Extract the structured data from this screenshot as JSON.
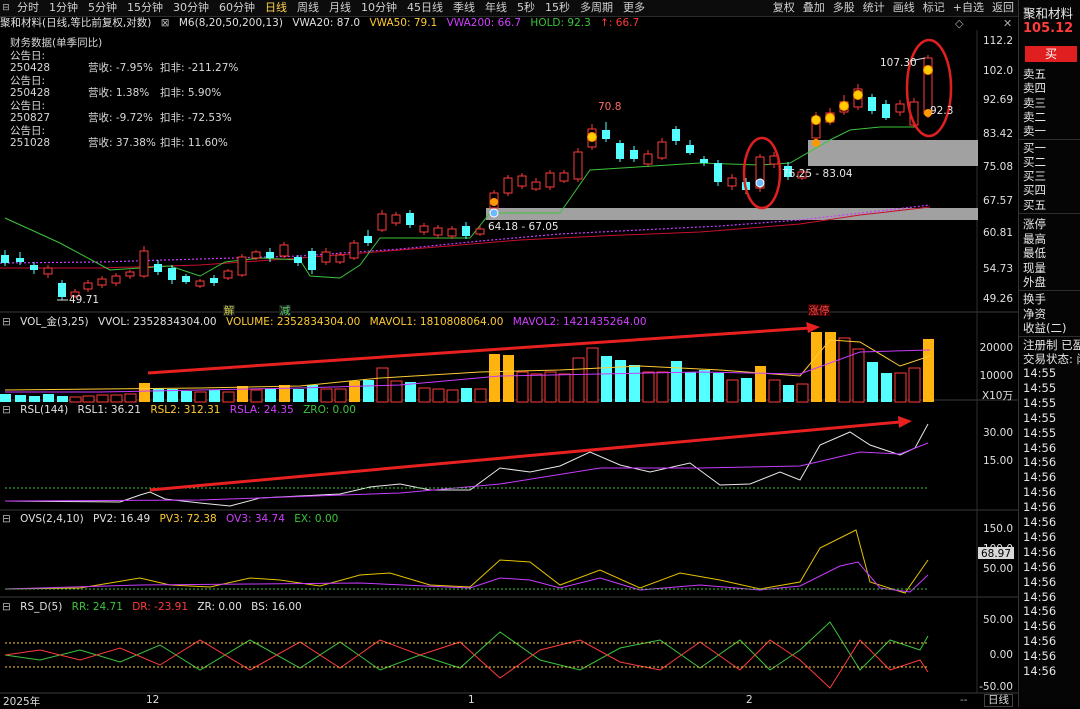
{
  "toolbar": {
    "periods": [
      "分时",
      "1分钟",
      "5分钟",
      "15分钟",
      "30分钟",
      "60分钟",
      "日线",
      "周线",
      "月线",
      "10分钟",
      "45日线",
      "季线",
      "年线",
      "5秒",
      "15秒",
      "多周期",
      "更多"
    ],
    "active_period": "日线",
    "tools": [
      "复权",
      "叠加",
      "多股",
      "统计",
      "画线",
      "标记",
      "+自选",
      "返回"
    ]
  },
  "info": {
    "stock_label": "聚和材料(日线,等比前复权,对数)",
    "ma_label": "M6(8,20,50,200,13)",
    "vwa20": "VWA20: 87.0",
    "vwa50": "VWA50: 79.1",
    "vwa200": "VWA200: 66.7",
    "hold": "HOLD: 92.3",
    "last": "↑: 66.7"
  },
  "financials": {
    "title": "财务数据(单季同比)",
    "rows": [
      {
        "date": "公告日: 250428",
        "rev": "营收:  -7.95%",
        "deduct": "扣非: -211.27%"
      },
      {
        "date": "公告日: 250428",
        "rev": "营收:  1.38%",
        "deduct": "扣非:  5.90%"
      },
      {
        "date": "公告日: 250827",
        "rev": "营收:  -9.72%",
        "deduct": "扣非: -72.53%"
      },
      {
        "date": "公告日: 251028",
        "rev": "营收:  37.38%",
        "deduct": "扣非:  11.60%"
      }
    ]
  },
  "price_axis": [
    "112.2",
    "102.0",
    "92.69",
    "83.42",
    "75.08",
    "67.57",
    "60.81",
    "54.73",
    "49.26"
  ],
  "annotations": {
    "high1": "70.8",
    "high2": "107.30",
    "low": "49.71",
    "zone1": "64.18 - 67.05",
    "zone2": "76.25 - 83.04",
    "label_small": "92.3",
    "tag_jie": "解",
    "tag_jian": "减",
    "tag_zhangting": "涨停"
  },
  "vol_panel": {
    "name": "VOL_金(3,25)",
    "vvol": "VVOL: 2352834304.00",
    "volume": "VOLUME: 2352834304.00",
    "mavol1": "MAVOL1: 1810808064.00",
    "mavol2": "MAVOL2: 1421435264.00",
    "axis": [
      "20000",
      "10000"
    ],
    "unit": "X10万"
  },
  "rsl_panel": {
    "name": "RSL(144)",
    "rsl1": "RSL1: 36.21",
    "rsl2": "RSL2: 312.31",
    "rsla": "RSLA: 24.35",
    "zro": "ZRO: 0.00",
    "axis": [
      "30.00",
      "15.00"
    ]
  },
  "ovs_panel": {
    "name": "OVS(2,4,10)",
    "pv2": "PV2: 16.49",
    "pv3": "PV3: 72.38",
    "ov3": "OV3: 34.74",
    "ex": "EX: 0.00",
    "axis": [
      "150.0",
      "100.0",
      "50.00"
    ],
    "marker": "68.97"
  },
  "rsd_panel": {
    "name": "RS_D(5)",
    "rr": "RR: 24.71",
    "dr": "DR: -23.91",
    "zr": "ZR: 0.00",
    "bs": "BS: 16.00",
    "axis": [
      "50.00",
      "0.00",
      "-50.00"
    ]
  },
  "date_axis": {
    "labels": [
      "2025年",
      "12",
      "1",
      "2"
    ],
    "period_btn": "日线"
  },
  "sidebar": {
    "title": "聚和材料",
    "price": "105.12",
    "buy": "买",
    "order_book": [
      "卖五",
      "卖四",
      "卖三",
      "卖二",
      "卖一",
      "买一",
      "买二",
      "买三",
      "买四",
      "买五"
    ],
    "stats": [
      "涨停",
      "最高",
      "最低",
      "现量",
      "外盘",
      "换手",
      "净资",
      "收益(二)",
      "注册制 已盈",
      "交易状态: 闭"
    ],
    "times": [
      "14:55",
      "14:55",
      "14:55",
      "14:55",
      "14:55",
      "14:56",
      "14:56",
      "14:56",
      "14:56",
      "14:56",
      "14:56",
      "14:56",
      "14:56",
      "14:56",
      "14:56",
      "14:56",
      "14:56",
      "14:56",
      "14:56",
      "14:56",
      "14:56"
    ]
  },
  "colors": {
    "up": "#ff3b3b",
    "down": "#54ffff",
    "vol_up": "#ffb30f",
    "ma_green": "#3cc43c",
    "ma_red": "#c8102e",
    "ma_magenta": "#c83cff",
    "white_line": "#e8e8e8",
    "yellow_line": "#e6c200"
  }
}
